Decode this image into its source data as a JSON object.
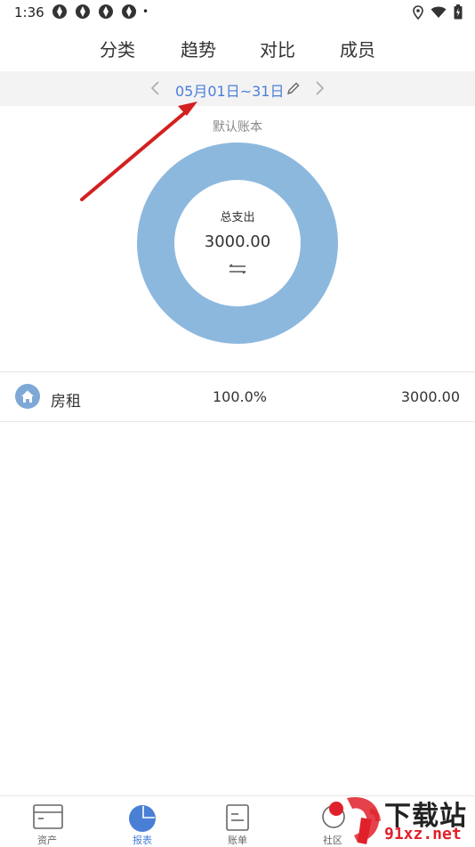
{
  "status_bar": {
    "time": "1:36",
    "dot": "•"
  },
  "top_tabs": [
    {
      "label": "分类",
      "active": true
    },
    {
      "label": "趋势",
      "active": false
    },
    {
      "label": "对比",
      "active": false
    },
    {
      "label": "成员",
      "active": false
    }
  ],
  "date_range": {
    "text": "05月01日~31日"
  },
  "book": {
    "name": "默认账本"
  },
  "donut": {
    "label": "总支出",
    "value": "3000.00",
    "color": "#8DB8DE"
  },
  "categories": [
    {
      "name": "房租",
      "percent": "100.0%",
      "amount": "3000.00",
      "icon": "home-icon",
      "share": 1.0
    }
  ],
  "bottom_nav": [
    {
      "label": "资产",
      "icon": "card-icon",
      "active": false
    },
    {
      "label": "报表",
      "icon": "pie-chart-icon",
      "active": true
    },
    {
      "label": "账单",
      "icon": "document-icon",
      "active": false
    },
    {
      "label": "社区",
      "icon": "chat-icon",
      "active": false
    }
  ],
  "watermark": {
    "top": "下载站",
    "bottom": "91xz.net"
  },
  "colors": {
    "accent": "#4A7FD6",
    "donut": "#8DB8DE",
    "arrow": "#D42020"
  }
}
